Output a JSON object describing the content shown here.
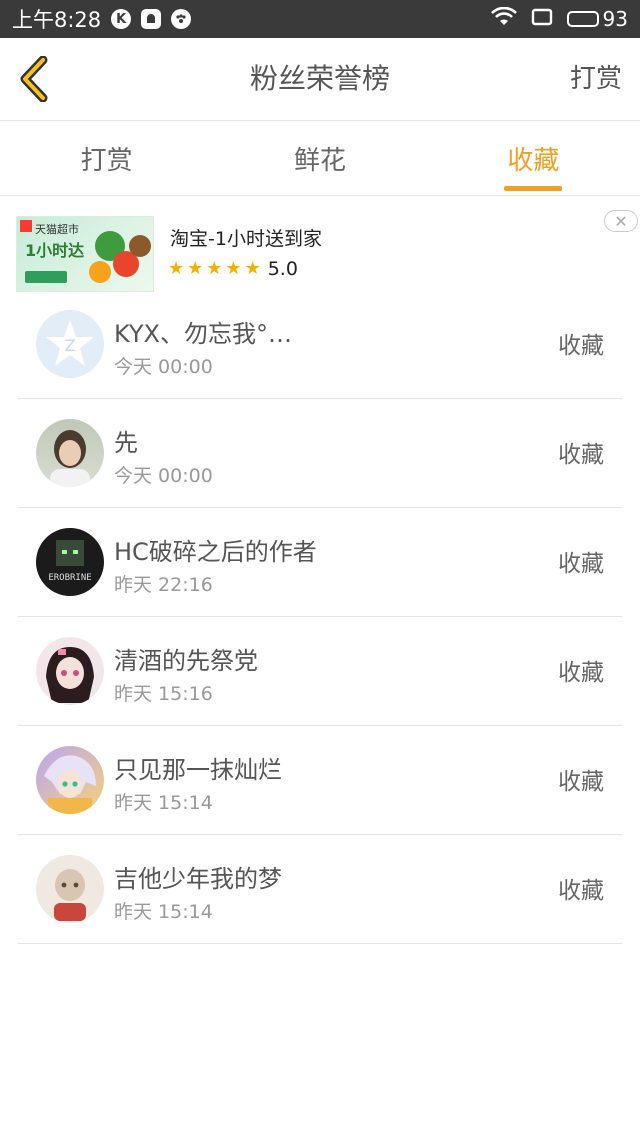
{
  "status_bar": {
    "time": "上午8:28",
    "icons": [
      "k-app-icon",
      "notification-app-icon",
      "game-app-icon"
    ],
    "battery": "93"
  },
  "navbar": {
    "title": "粉丝荣誉榜",
    "right_label": "打赏"
  },
  "tabs": [
    {
      "label": "打赏"
    },
    {
      "label": "鲜花"
    },
    {
      "label": "收藏"
    }
  ],
  "active_tab": "收藏",
  "ad": {
    "image_text_1": "天猫超市",
    "image_text_2": "1小时达",
    "title": "淘宝-1小时送到家",
    "rating": "5.0",
    "stars": 5
  },
  "list": [
    {
      "name": "KYX、勿忘我°…",
      "time": "今天 00:00",
      "action": "收藏"
    },
    {
      "name": "先",
      "time": "今天 00:00",
      "action": "收藏"
    },
    {
      "name": "HC破碎之后的作者",
      "time": "昨天 22:16",
      "action": "收藏"
    },
    {
      "name": "清酒的先祭党",
      "time": "昨天 15:16",
      "action": "收藏"
    },
    {
      "name": "只见那一抹灿烂",
      "time": "昨天 15:14",
      "action": "收藏"
    },
    {
      "name": "吉他少年我的梦",
      "time": "昨天 15:14",
      "action": "收藏"
    }
  ],
  "colors": {
    "accent": "#f0a020",
    "status_bar": "#3a3a3a"
  }
}
